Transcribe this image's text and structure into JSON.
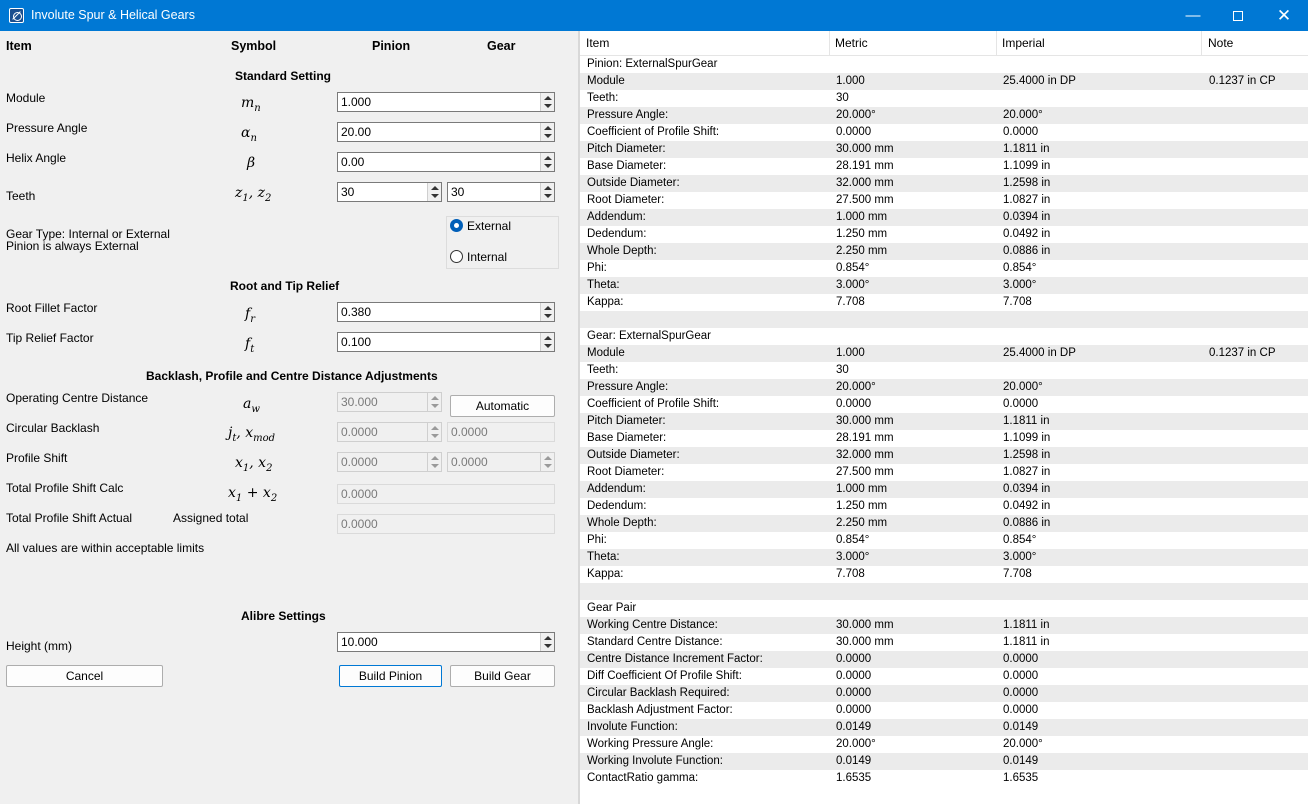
{
  "window": {
    "title": "Involute Spur & Helical Gears"
  },
  "left": {
    "headers": {
      "item": "Item",
      "symbol": "Symbol",
      "pinion": "Pinion",
      "gear": "Gear"
    },
    "sections": {
      "standard": "Standard Setting",
      "relief": "Root and Tip Relief",
      "backlash": "Backlash, Profile and Centre Distance Adjustments",
      "alibre": "Alibre Settings"
    },
    "module": {
      "label": "Module",
      "value": "1.000"
    },
    "pressure_angle": {
      "label": "Pressure Angle",
      "value": "20.00"
    },
    "helix_angle": {
      "label": "Helix Angle",
      "value": "0.00"
    },
    "teeth": {
      "label": "Teeth",
      "pinion": "30",
      "gear": "30"
    },
    "gear_type": {
      "line1": "Gear Type: Internal or External",
      "line2": "Pinion is always External",
      "external": "External",
      "internal": "Internal",
      "selected": "External"
    },
    "root_fillet": {
      "label": "Root Fillet Factor",
      "value": "0.380"
    },
    "tip_relief": {
      "label": "Tip Relief Factor",
      "value": "0.100"
    },
    "centre_distance": {
      "label": "Operating Centre Distance",
      "value": "30.000",
      "button": "Automatic"
    },
    "circular_backlash": {
      "label": "Circular Backlash",
      "value": "0.0000",
      "value2": "0.0000"
    },
    "profile_shift": {
      "label": "Profile Shift",
      "pinion": "0.0000",
      "gear": "0.0000"
    },
    "total_calc": {
      "label": "Total Profile Shift Calc",
      "value": "0.0000"
    },
    "total_actual": {
      "label": "Total Profile Shift Actual",
      "assigned": "Assigned total",
      "value": "0.0000"
    },
    "status": "All values are within acceptable limits",
    "height": {
      "label": "Height (mm)",
      "value": "10.000"
    },
    "buttons": {
      "cancel": "Cancel",
      "build_pinion": "Build Pinion",
      "build_gear": "Build Gear"
    }
  },
  "table": {
    "columns": [
      "Item",
      "Metric",
      "Imperial",
      "Note"
    ],
    "rows": [
      [
        "Pinion: ExternalSpurGear",
        "",
        "",
        ""
      ],
      [
        "Module",
        "1.000",
        "25.4000 in DP",
        "0.1237 in CP"
      ],
      [
        "Teeth:",
        "30",
        "",
        ""
      ],
      [
        "Pressure Angle:",
        "20.000°",
        "20.000°",
        ""
      ],
      [
        "Coefficient of Profile Shift:",
        "0.0000",
        "0.0000",
        ""
      ],
      [
        "Pitch Diameter:",
        "30.000 mm",
        "1.1811 in",
        ""
      ],
      [
        "Base Diameter:",
        "28.191 mm",
        "1.1099 in",
        ""
      ],
      [
        "Outside Diameter:",
        "32.000 mm",
        "1.2598 in",
        ""
      ],
      [
        "Root Diameter:",
        "27.500 mm",
        "1.0827 in",
        ""
      ],
      [
        "Addendum:",
        "1.000 mm",
        "0.0394 in",
        ""
      ],
      [
        "Dedendum:",
        "1.250 mm",
        "0.0492 in",
        ""
      ],
      [
        "Whole Depth:",
        "2.250 mm",
        "0.0886 in",
        ""
      ],
      [
        "Phi:",
        "0.854°",
        "0.854°",
        ""
      ],
      [
        "Theta:",
        "3.000°",
        "3.000°",
        ""
      ],
      [
        "Kappa:",
        "7.708",
        "7.708",
        ""
      ],
      [
        "",
        "",
        "",
        ""
      ],
      [
        "Gear: ExternalSpurGear",
        "",
        "",
        ""
      ],
      [
        "Module",
        "1.000",
        "25.4000 in DP",
        "0.1237 in CP"
      ],
      [
        "Teeth:",
        "30",
        "",
        ""
      ],
      [
        "Pressure Angle:",
        "20.000°",
        "20.000°",
        ""
      ],
      [
        "Coefficient of Profile Shift:",
        "0.0000",
        "0.0000",
        ""
      ],
      [
        "Pitch Diameter:",
        "30.000 mm",
        "1.1811 in",
        ""
      ],
      [
        "Base Diameter:",
        "28.191 mm",
        "1.1099 in",
        ""
      ],
      [
        "Outside Diameter:",
        "32.000 mm",
        "1.2598 in",
        ""
      ],
      [
        "Root Diameter:",
        "27.500 mm",
        "1.0827 in",
        ""
      ],
      [
        "Addendum:",
        "1.000 mm",
        "0.0394 in",
        ""
      ],
      [
        "Dedendum:",
        "1.250 mm",
        "0.0492 in",
        ""
      ],
      [
        "Whole Depth:",
        "2.250 mm",
        "0.0886 in",
        ""
      ],
      [
        "Phi:",
        "0.854°",
        "0.854°",
        ""
      ],
      [
        "Theta:",
        "3.000°",
        "3.000°",
        ""
      ],
      [
        "Kappa:",
        "7.708",
        "7.708",
        ""
      ],
      [
        "",
        "",
        "",
        ""
      ],
      [
        "Gear Pair",
        "",
        "",
        ""
      ],
      [
        "Working Centre Distance:",
        "30.000 mm",
        "1.1811 in",
        ""
      ],
      [
        "Standard Centre Distance:",
        "30.000 mm",
        "1.1811 in",
        ""
      ],
      [
        "Centre Distance Increment Factor:",
        "0.0000",
        "0.0000",
        ""
      ],
      [
        "Diff Coefficient Of Profile Shift:",
        "0.0000",
        "0.0000",
        ""
      ],
      [
        "Circular Backlash Required:",
        "0.0000",
        "0.0000",
        ""
      ],
      [
        "Backlash Adjustment Factor:",
        "0.0000",
        "0.0000",
        ""
      ],
      [
        "Involute Function:",
        "0.0149",
        "0.0149",
        ""
      ],
      [
        "Working Pressure Angle:",
        "20.000°",
        "20.000°",
        ""
      ],
      [
        "Working Involute Function:",
        "0.0149",
        "0.0149",
        ""
      ],
      [
        "ContactRatio gamma:",
        "1.6535",
        "1.6535",
        ""
      ]
    ]
  }
}
